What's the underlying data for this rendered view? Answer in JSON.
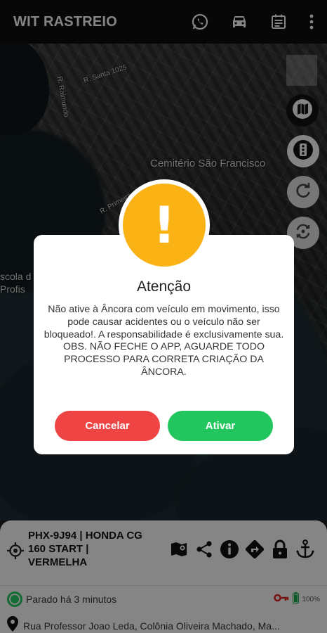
{
  "app": {
    "title": "WIT RASTREIO"
  },
  "appbar_icons": [
    "whatsapp-icon",
    "car-icon",
    "calendar-list-icon",
    "more-vert-icon"
  ],
  "map": {
    "labels": {
      "cemetery": "Cemitério São Francisco",
      "school": "scola d\nProfis",
      "street1": "R. Santa 1025",
      "street2": "R. Primeira",
      "street3": "R. Raimundo"
    },
    "controls": [
      "my-location-icon",
      "map-layers-icon",
      "traffic-light-icon",
      "refresh-icon",
      "sync-icon"
    ]
  },
  "panel": {
    "vehicle": "PHX-9J94 | HONDA CG 160 START | VERMELHA",
    "actions": [
      "route-map-icon",
      "share-icon",
      "info-icon",
      "directions-icon",
      "lock-icon",
      "anchor-icon"
    ],
    "status": "Parado há 3 minutos",
    "battery": "100%",
    "address": "Rua Professor Joao Leda, Colônia Oliveira Machado, Ma..."
  },
  "dialog": {
    "title": "Atenção",
    "message": "Não ative à Âncora com veículo em movimento, isso pode causar acidentes ou o veículo não ser bloqueado!. A responsabilidade é exclusivamente sua. OBS. NÃO FECHE O APP, AGUARDE TODO PROCESSO PARA CORRETA CRIAÇÃO DA ÂNCORA.",
    "cancel_label": "Cancelar",
    "confirm_label": "Ativar",
    "icon": "exclamation-icon"
  },
  "colors": {
    "warning": "#fbb215",
    "cancel": "#ef4444",
    "confirm": "#22c55e",
    "appbar": "#0e0e0e"
  }
}
